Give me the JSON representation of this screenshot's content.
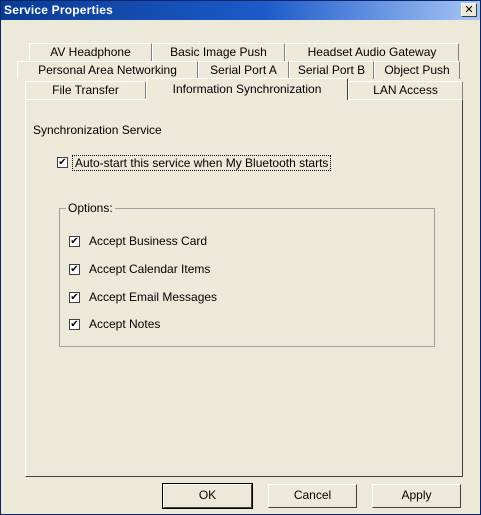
{
  "window": {
    "title": "Service Properties",
    "close_glyph": "✕"
  },
  "tabs": {
    "row1": [
      "AV Headphone",
      "Basic Image Push",
      "Headset Audio Gateway"
    ],
    "row2": [
      "Personal Area Networking",
      "Serial Port A",
      "Serial Port B",
      "Object Push"
    ],
    "row3": [
      "File Transfer",
      "Information Synchronization",
      "LAN Access"
    ],
    "active": "Information Synchronization"
  },
  "panel": {
    "section_title": "Synchronization Service",
    "autostart": {
      "label": "Auto-start this service when My Bluetooth starts",
      "checked": true
    },
    "options": {
      "legend": "Options:",
      "items": [
        {
          "label": "Accept Business Card",
          "checked": true
        },
        {
          "label": "Accept Calendar Items",
          "checked": true
        },
        {
          "label": "Accept Email Messages",
          "checked": true
        },
        {
          "label": "Accept Notes",
          "checked": true
        }
      ]
    }
  },
  "buttons": {
    "ok": "OK",
    "cancel": "Cancel",
    "apply": "Apply"
  },
  "icons": {
    "check_glyph": "✔",
    "close": "close-icon"
  },
  "colors": {
    "face": "#ece9d8",
    "title_start": "#0a3b92",
    "title_end": "#a6c6f5"
  }
}
